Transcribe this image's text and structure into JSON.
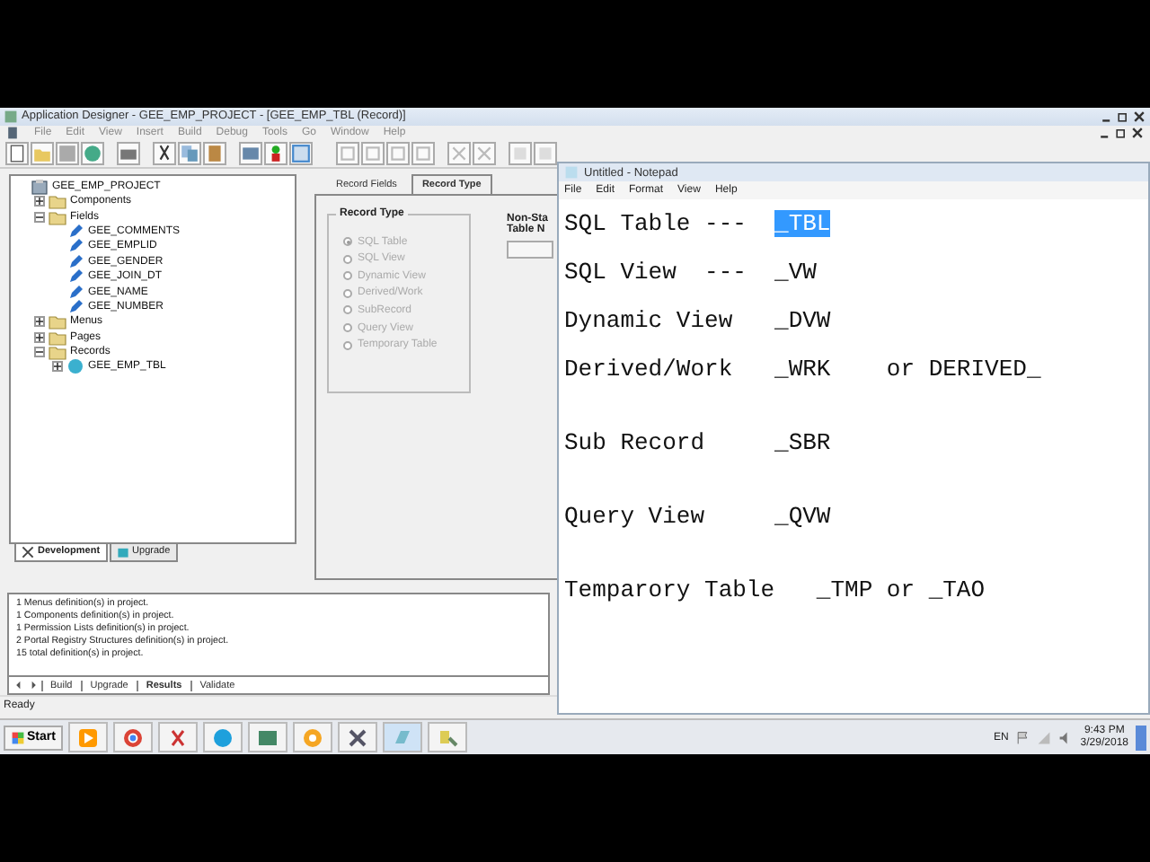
{
  "designer": {
    "title": "Application Designer - GEE_EMP_PROJECT - [GEE_EMP_TBL (Record)]",
    "menu": [
      "File",
      "Edit",
      "View",
      "Insert",
      "Build",
      "Debug",
      "Tools",
      "Go",
      "Window",
      "Help"
    ],
    "project_tree": {
      "label": "GEE_EMP_PROJECT",
      "kind": "project",
      "children": [
        {
          "label": "Components",
          "kind": "folder",
          "expanded": false
        },
        {
          "label": "Fields",
          "kind": "folder",
          "expanded": true,
          "children": [
            {
              "label": "GEE_COMMENTS",
              "kind": "field"
            },
            {
              "label": "GEE_EMPLID",
              "kind": "field"
            },
            {
              "label": "GEE_GENDER",
              "kind": "field"
            },
            {
              "label": "GEE_JOIN_DT",
              "kind": "field"
            },
            {
              "label": "GEE_NAME",
              "kind": "field"
            },
            {
              "label": "GEE_NUMBER",
              "kind": "field"
            }
          ]
        },
        {
          "label": "Menus",
          "kind": "folder",
          "expanded": false
        },
        {
          "label": "Pages",
          "kind": "folder",
          "expanded": false
        },
        {
          "label": "Records",
          "kind": "folder",
          "expanded": true,
          "children": [
            {
              "label": "GEE_EMP_TBL",
              "kind": "record",
              "expanded": false
            }
          ]
        }
      ]
    },
    "project_tabs": [
      {
        "label": "Development",
        "selected": true
      },
      {
        "label": "Upgrade",
        "selected": false
      }
    ],
    "record_tabs": [
      {
        "label": "Record Fields",
        "selected": false
      },
      {
        "label": "Record Type",
        "selected": true
      }
    ],
    "record_type": {
      "title": "Record Type",
      "options": [
        {
          "label": "SQL Table",
          "selected": true,
          "disabled": true
        },
        {
          "label": "SQL View",
          "selected": false,
          "disabled": true
        },
        {
          "label": "Dynamic View",
          "selected": false,
          "disabled": true
        },
        {
          "label": "Derived/Work",
          "selected": false,
          "disabled": true
        },
        {
          "label": "SubRecord",
          "selected": false,
          "disabled": true
        },
        {
          "label": "Query View",
          "selected": false,
          "disabled": true
        },
        {
          "label": "Temporary Table",
          "selected": false,
          "disabled": true
        }
      ]
    },
    "non_standard_label": [
      "Non-Sta",
      "Table N"
    ],
    "output_lines": [
      "1 Menus  definition(s) in project.",
      "1 Components  definition(s) in project.",
      "1 Permission Lists  definition(s) in project.",
      "2 Portal Registry Structures  definition(s) in project.",
      "15  total definition(s) in project."
    ],
    "output_tabs": [
      {
        "label": "Build",
        "selected": false
      },
      {
        "label": "Upgrade",
        "selected": false
      },
      {
        "label": "Results",
        "selected": true
      },
      {
        "label": "Validate",
        "selected": false
      }
    ],
    "status": "Ready"
  },
  "notepad": {
    "title": "Untitled - Notepad",
    "menu": [
      "File",
      "Edit",
      "Format",
      "View",
      "Help"
    ],
    "lines": [
      {
        "spans": [
          {
            "text": "SQL Table ---  ",
            "selected": false
          },
          {
            "text": "_TBL",
            "selected": true
          }
        ]
      },
      {
        "spans": [
          {
            "text": "SQL View  ---  _VW",
            "selected": false
          }
        ]
      },
      {
        "spans": [
          {
            "text": "Dynamic View   _DVW",
            "selected": false
          }
        ]
      },
      {
        "spans": [
          {
            "text": "Derived/Work   _WRK    or DERIVED_",
            "selected": false
          }
        ]
      },
      {
        "spans": [
          {
            "text": "Sub Record     _SBR",
            "selected": false
          }
        ]
      },
      {
        "spans": [
          {
            "text": "Query View     _QVW",
            "selected": false
          }
        ]
      },
      {
        "spans": [
          {
            "text": "Temparory Table   _TMP or _TAO",
            "selected": false
          }
        ]
      }
    ]
  },
  "taskbar": {
    "start": "Start",
    "language": "EN",
    "time": "9:43 PM",
    "date": "3/29/2018"
  }
}
